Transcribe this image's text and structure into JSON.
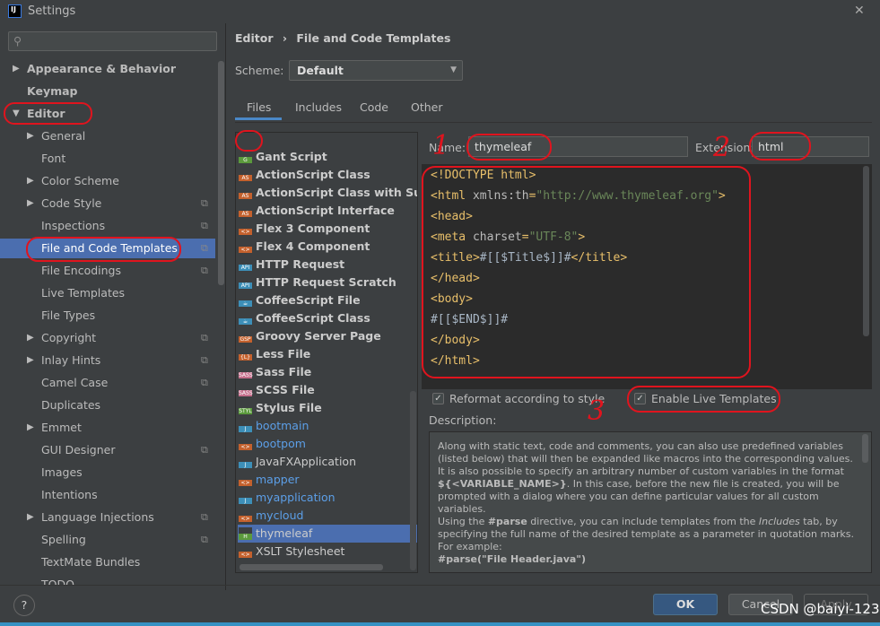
{
  "window": {
    "title": "Settings",
    "close": "✕"
  },
  "sidebar": {
    "items": [
      {
        "label": "Appearance & Behavior",
        "arrow": "▶",
        "bold": true
      },
      {
        "label": "Keymap",
        "arrow": "",
        "bold": true
      },
      {
        "label": "Editor",
        "arrow": "▼",
        "bold": true
      },
      {
        "label": "General",
        "arrow": "▶"
      },
      {
        "label": "Font",
        "arrow": ""
      },
      {
        "label": "Color Scheme",
        "arrow": "▶"
      },
      {
        "label": "Code Style",
        "arrow": "▶",
        "copy": true
      },
      {
        "label": "Inspections",
        "arrow": "",
        "copy": true
      },
      {
        "label": "File and Code Templates",
        "arrow": "",
        "copy": true,
        "selected": true
      },
      {
        "label": "File Encodings",
        "arrow": "",
        "copy": true
      },
      {
        "label": "Live Templates",
        "arrow": ""
      },
      {
        "label": "File Types",
        "arrow": ""
      },
      {
        "label": "Copyright",
        "arrow": "▶",
        "copy": true
      },
      {
        "label": "Inlay Hints",
        "arrow": "▶",
        "copy": true
      },
      {
        "label": "Camel Case",
        "arrow": "",
        "copy": true
      },
      {
        "label": "Duplicates",
        "arrow": ""
      },
      {
        "label": "Emmet",
        "arrow": "▶"
      },
      {
        "label": "GUI Designer",
        "arrow": "",
        "copy": true
      },
      {
        "label": "Images",
        "arrow": ""
      },
      {
        "label": "Intentions",
        "arrow": ""
      },
      {
        "label": "Language Injections",
        "arrow": "▶",
        "copy": true
      },
      {
        "label": "Spelling",
        "arrow": "",
        "copy": true
      },
      {
        "label": "TextMate Bundles",
        "arrow": ""
      },
      {
        "label": "TODO",
        "arrow": ""
      }
    ]
  },
  "breadcrumb": {
    "parent": "Editor",
    "sep": "›",
    "current": "File and Code Templates"
  },
  "scheme": {
    "label": "Scheme:",
    "value": "Default"
  },
  "tabs": [
    "Files",
    "Includes",
    "Code",
    "Other"
  ],
  "toolbar": {
    "add": "+",
    "remove": "−",
    "copy": "⧉",
    "reset": "↶"
  },
  "files": [
    {
      "name": "Gant Script",
      "bold": true,
      "icon": "G",
      "color": "#5b9a3c"
    },
    {
      "name": "ActionScript Class",
      "bold": true,
      "icon": "AS",
      "color": "#c4612d"
    },
    {
      "name": "ActionScript Class with Supers",
      "bold": true,
      "icon": "AS",
      "color": "#c4612d"
    },
    {
      "name": "ActionScript Interface",
      "bold": true,
      "icon": "AS",
      "color": "#c4612d"
    },
    {
      "name": "Flex 3 Component",
      "bold": true,
      "icon": "<>",
      "color": "#c4612d"
    },
    {
      "name": "Flex 4 Component",
      "bold": true,
      "icon": "<>",
      "color": "#c4612d"
    },
    {
      "name": "HTTP Request",
      "bold": true,
      "icon": "API",
      "color": "#3d8fb8"
    },
    {
      "name": "HTTP Request Scratch",
      "bold": true,
      "icon": "API",
      "color": "#3d8fb8"
    },
    {
      "name": "CoffeeScript File",
      "bold": true,
      "icon": "☕",
      "color": "#3d8fb8"
    },
    {
      "name": "CoffeeScript Class",
      "bold": true,
      "icon": "☕",
      "color": "#3d8fb8"
    },
    {
      "name": "Groovy Server Page",
      "bold": true,
      "icon": "GSP",
      "color": "#c4612d"
    },
    {
      "name": "Less File",
      "bold": true,
      "icon": "{L}",
      "color": "#c4612d"
    },
    {
      "name": "Sass File",
      "bold": true,
      "icon": "SASS",
      "color": "#c66f8c"
    },
    {
      "name": "SCSS File",
      "bold": true,
      "icon": "SASS",
      "color": "#c66f8c"
    },
    {
      "name": "Stylus File",
      "bold": true,
      "icon": "STYL",
      "color": "#5b9a3c"
    },
    {
      "name": "bootmain",
      "custom": true,
      "icon": "J",
      "color": "#3d8fb8"
    },
    {
      "name": "bootpom",
      "custom": true,
      "icon": "<>",
      "color": "#c4612d"
    },
    {
      "name": "JavaFXApplication",
      "icon": "J",
      "color": "#3d8fb8"
    },
    {
      "name": "mapper",
      "custom": true,
      "icon": "<>",
      "color": "#c4612d"
    },
    {
      "name": "myapplication",
      "custom": true,
      "icon": "J",
      "color": "#3d8fb8"
    },
    {
      "name": "mycloud",
      "custom": true,
      "icon": "<>",
      "color": "#c4612d"
    },
    {
      "name": "thymeleaf",
      "custom": true,
      "icon": "H",
      "color": "#5b9a3c",
      "selected": true
    },
    {
      "name": "XSLT Stylesheet",
      "icon": "<>",
      "color": "#c4612d"
    }
  ],
  "template": {
    "name_label": "Name:",
    "name_value": "thymeleaf",
    "ext_label": "Extension:",
    "ext_value": "html",
    "code": [
      "<!DOCTYPE html>",
      "<html xmlns:th=\"http://www.thymeleaf.org\">",
      "<head>",
      "<meta charset=\"UTF-8\">",
      "<title>#[[$Title$]]#</title>",
      "</head>",
      "<body>",
      "#[[$END$]]#",
      "</body>",
      "</html>"
    ],
    "reformat": "Reformat according to style",
    "live_templates": "Enable Live Templates",
    "description_label": "Description:"
  },
  "description": [
    "Along with static text, code and comments, you can also use predefined variables (listed below) that will then be expanded like macros into the corresponding values.",
    "It is also possible to specify an arbitrary number of custom variables in the format ${<VARIABLE_NAME>}. In this case, before the new file is created, you will be prompted with a dialog where you can define particular values for all custom variables.",
    "Using the #parse directive, you can include templates from the Includes tab, by specifying the full name of the desired template as a parameter in quotation marks. For example:",
    "#parse(\"File Header.java\")"
  ],
  "footer": {
    "help": "?",
    "ok": "OK",
    "cancel": "Cancel",
    "apply": "Apply"
  },
  "annotations": [
    "1",
    "2",
    "3"
  ],
  "watermark": "CSDN @baiyi-123",
  "colors": {
    "selection": "#4b6eaf",
    "annotation": "#e0141e",
    "accent": "#4a88c7",
    "custom_template": "#5c9fe8"
  }
}
